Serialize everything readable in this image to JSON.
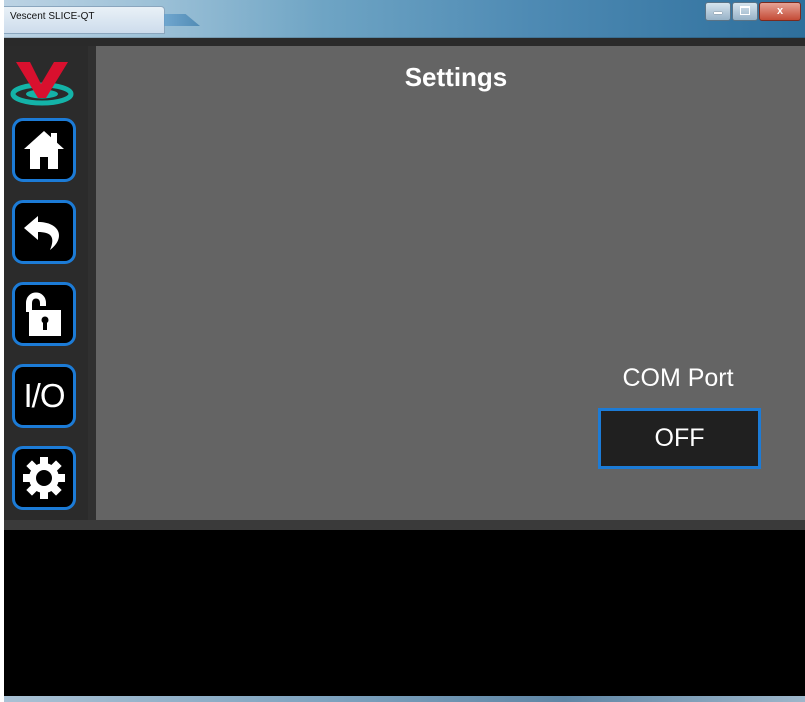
{
  "window": {
    "title": "Vescent SLICE-QT",
    "controls": {
      "minimize_icon": "minimize-icon",
      "maximize_icon": "maximize-icon",
      "close_label": "x"
    }
  },
  "sidebar": {
    "logo": {
      "letter": "V",
      "brand_color": "#d8102e",
      "ring_color": "#14b3a8"
    },
    "items": [
      {
        "name": "home",
        "icon": "home-icon"
      },
      {
        "name": "back",
        "icon": "undo-arrow-icon"
      },
      {
        "name": "lock",
        "icon": "unlock-icon"
      },
      {
        "name": "io",
        "label": "I/O"
      },
      {
        "name": "settings",
        "icon": "gear-icon"
      }
    ],
    "accent_color": "#1c7bd6"
  },
  "main": {
    "title": "Settings",
    "com_port": {
      "label": "COM Port",
      "button_label": "OFF"
    }
  }
}
